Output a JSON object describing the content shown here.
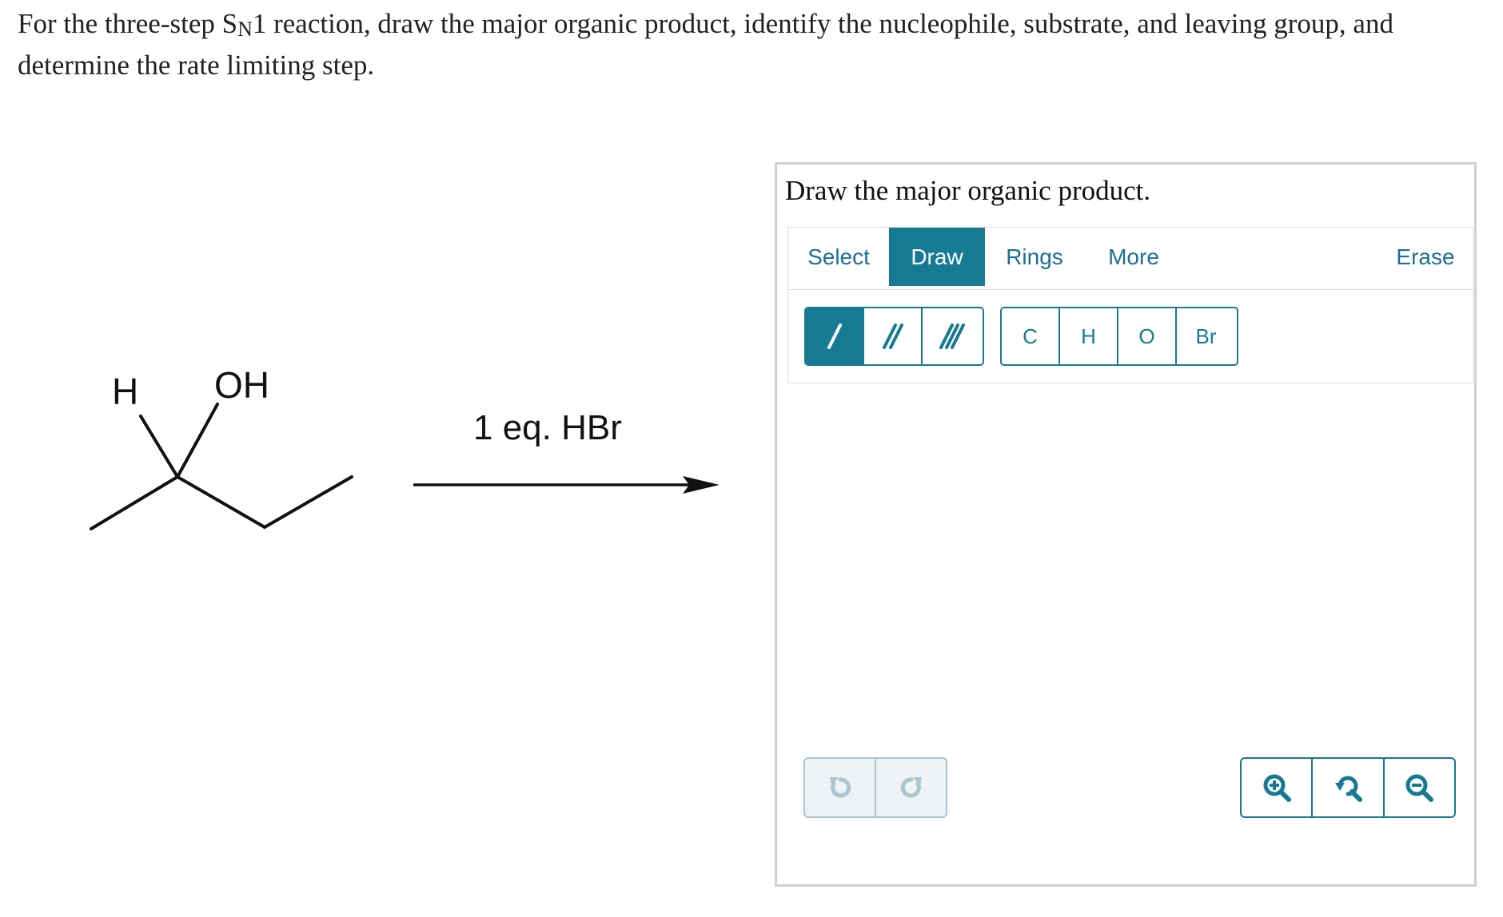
{
  "question": {
    "part1": "For the three-step S",
    "sub": "N",
    "part2": "1 reaction, draw the major organic product, identify the nucleophile, substrate, and leaving group, and determine the rate limiting step."
  },
  "reaction": {
    "atom_h": "H",
    "atom_oh": "OH",
    "reagent": "1 eq. HBr"
  },
  "panel": {
    "title": "Draw the major organic product.",
    "tabs": [
      "Select",
      "Draw",
      "Rings",
      "More"
    ],
    "active_tab": "Draw",
    "erase_label": "Erase",
    "bond_tools": [
      "single-bond",
      "double-bond",
      "triple-bond"
    ],
    "atoms": [
      "C",
      "H",
      "O",
      "Br"
    ]
  },
  "colors": {
    "accent": "#167a94",
    "tab_text": "#1a6f94",
    "panel_border": "#cfcfcf",
    "disabled": "#a9c5d0"
  }
}
